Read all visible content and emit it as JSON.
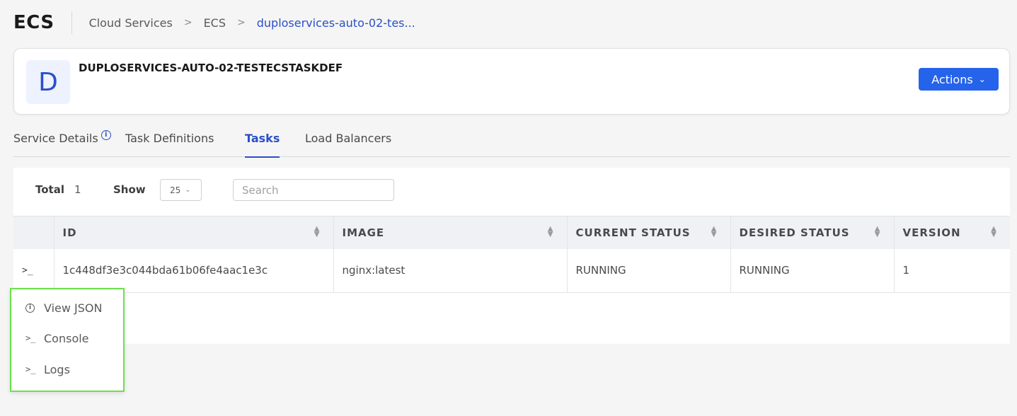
{
  "header": {
    "app_title": "ECS",
    "breadcrumbs": [
      "Cloud Services",
      "ECS",
      "duploservices-auto-02-tes..."
    ],
    "separator": ">"
  },
  "service": {
    "avatar_letter": "D",
    "name": "DUPLOSERVICES-AUTO-02-TESTECSTASKDEF",
    "actions_label": "Actions",
    "actions_icon": "chevron-down-icon"
  },
  "tabs": [
    {
      "label": "Service Details",
      "icon": "info-icon"
    },
    {
      "label": "Task Definitions"
    },
    {
      "label": "Tasks",
      "active": true
    },
    {
      "label": "Load Balancers"
    }
  ],
  "controls": {
    "total_label": "Total",
    "total_value": "1",
    "show_label": "Show",
    "show_value": "25",
    "search_placeholder": "Search"
  },
  "table": {
    "columns": [
      "ID",
      "IMAGE",
      "CURRENT STATUS",
      "DESIRED STATUS",
      "VERSION"
    ],
    "rows": [
      {
        "expand": ">_",
        "id": "1c448df3e3c044bda61b06fe4aac1e3c",
        "image": "nginx:latest",
        "current_status": "RUNNING",
        "desired_status": "RUNNING",
        "version": "1"
      }
    ]
  },
  "context_menu": {
    "items": [
      {
        "label": "View JSON",
        "icon": "info-icon"
      },
      {
        "label": "Console",
        "icon": "terminal-icon",
        "glyph": ">_"
      },
      {
        "label": "Logs",
        "icon": "terminal-icon",
        "glyph": ">_"
      }
    ]
  },
  "colors": {
    "accent": "#2a4fc9",
    "button": "#2563eb",
    "highlight_border": "#6be04a"
  }
}
